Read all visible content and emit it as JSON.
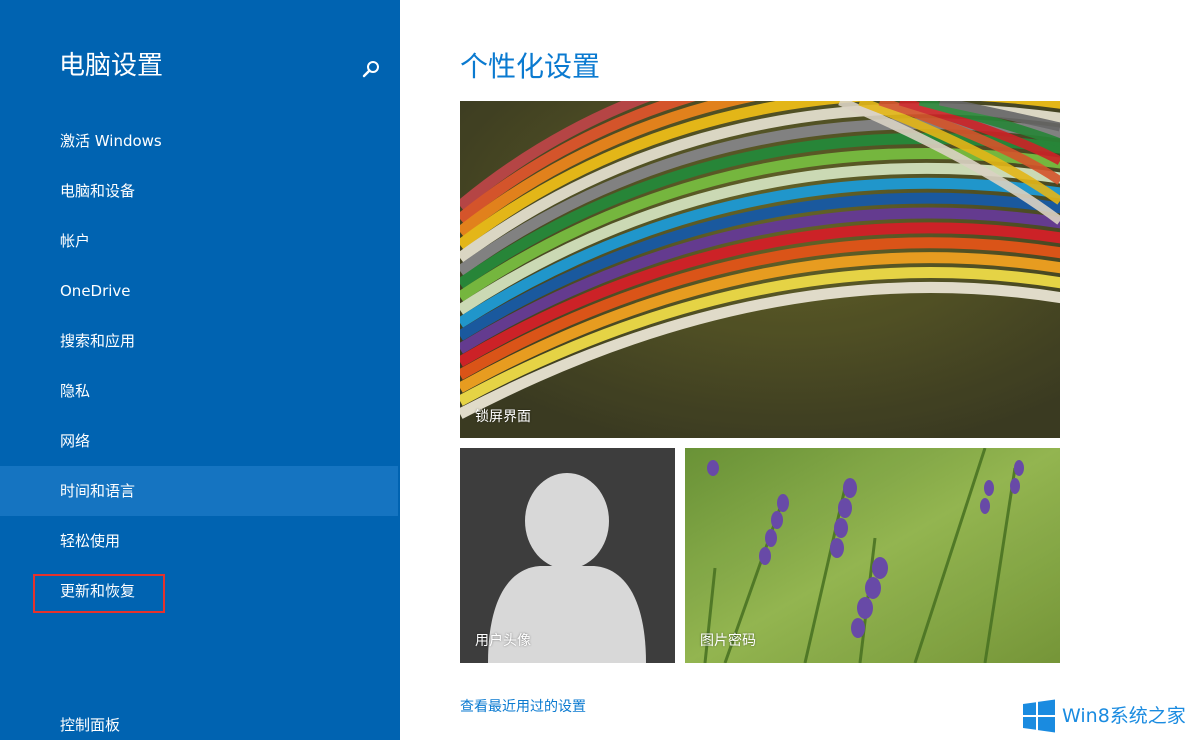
{
  "sidebar": {
    "title": "电脑设置",
    "items": [
      {
        "label": "激活 Windows"
      },
      {
        "label": "电脑和设备"
      },
      {
        "label": "帐户"
      },
      {
        "label": "OneDrive"
      },
      {
        "label": "搜索和应用"
      },
      {
        "label": "隐私"
      },
      {
        "label": "网络"
      },
      {
        "label": "时间和语言",
        "selected": true
      },
      {
        "label": "轻松使用"
      },
      {
        "label": "更新和恢复",
        "highlighted": true
      }
    ],
    "control_panel": "控制面板"
  },
  "main": {
    "title": "个性化设置",
    "tiles": {
      "lock_screen": "锁屏界面",
      "account_picture": "用户头像",
      "picture_password": "图片密码"
    },
    "recent_link": "查看最近用过的设置"
  },
  "watermark": {
    "text": "Win8系统之家"
  },
  "colors": {
    "sidebar_bg": "#0063b1",
    "selected_bg": "#1574c1",
    "accent": "#0a7ad0",
    "highlight_border": "#e5322d"
  },
  "icons": {
    "search": "search-icon",
    "windows_logo": "windows-logo-icon"
  }
}
